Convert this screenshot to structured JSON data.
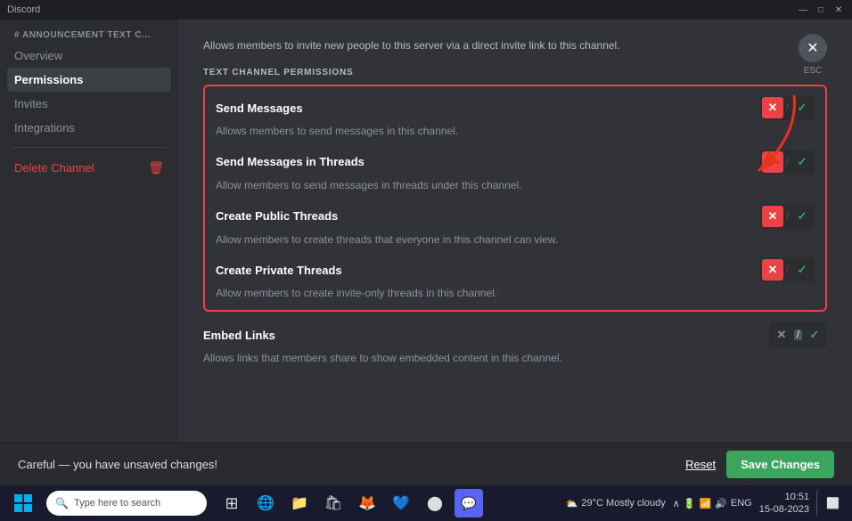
{
  "titlebar": {
    "app_name": "Discord",
    "min_btn": "—",
    "max_btn": "□",
    "close_btn": "✕"
  },
  "sidebar": {
    "channel_label": "# ANNOUNCEMENT TEXT C...",
    "items": [
      {
        "id": "overview",
        "label": "Overview",
        "active": false
      },
      {
        "id": "permissions",
        "label": "Permissions",
        "active": true
      },
      {
        "id": "invites",
        "label": "Invites",
        "active": false
      },
      {
        "id": "integrations",
        "label": "Integrations",
        "active": false
      }
    ],
    "delete_label": "Delete Channel"
  },
  "main": {
    "invite_desc": "Allows members to invite new people to this server via a direct invite link to this channel.",
    "text_channel_permissions_label": "TEXT CHANNEL PERMISSIONS",
    "permissions": [
      {
        "id": "send-messages",
        "name": "Send Messages",
        "desc": "Allows members to send messages in this channel.",
        "state": "deny",
        "highlighted": true
      },
      {
        "id": "send-messages-threads",
        "name": "Send Messages in Threads",
        "desc": "Allow members to send messages in threads under this channel.",
        "state": "deny",
        "highlighted": true
      },
      {
        "id": "create-public-threads",
        "name": "Create Public Threads",
        "desc": "Allow members to create threads that everyone in this channel can view.",
        "state": "deny",
        "highlighted": true
      },
      {
        "id": "create-private-threads",
        "name": "Create Private Threads",
        "desc": "Allow members to create invite-only threads in this channel.",
        "state": "deny",
        "highlighted": true
      },
      {
        "id": "embed-links",
        "name": "Embed Links",
        "desc": "Allows links that members share to show embedded content in this channel.",
        "state": "neutral",
        "highlighted": false
      }
    ]
  },
  "unsaved_bar": {
    "message": "Careful — you have unsaved changes!",
    "reset_label": "Reset",
    "save_label": "Save Changes"
  },
  "taskbar": {
    "search_placeholder": "Type here to search",
    "weather": "29°C  Mostly cloudy",
    "time": "10:51",
    "date": "15-08-2023",
    "lang": "ENG"
  },
  "esc": {
    "label": "ESC"
  },
  "colors": {
    "deny": "#ed4245",
    "allow": "#3ba55d",
    "save_bg": "#3ba55d",
    "highlight_border": "#ed4245"
  }
}
